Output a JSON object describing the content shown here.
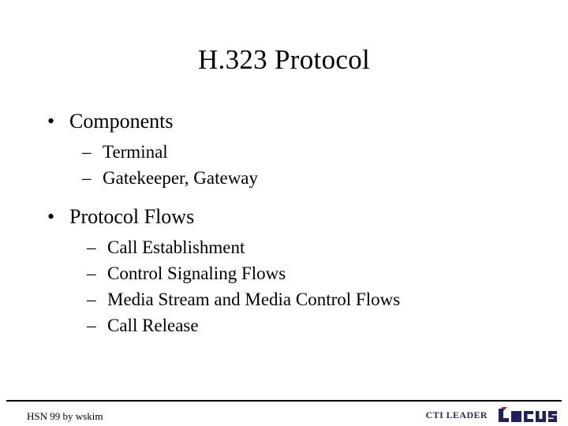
{
  "slide": {
    "title": "H.323 Protocol",
    "background_color": "#ffffff",
    "text_color": "#000000",
    "outline": [
      {
        "level": 1,
        "marker": "bullet-dot",
        "text": "Components",
        "children": [
          {
            "level": 2,
            "marker": "en-dash",
            "text": "Terminal"
          },
          {
            "level": 2,
            "marker": "en-dash",
            "text": "Gatekeeper, Gateway"
          }
        ]
      },
      {
        "level": 1,
        "marker": "bullet-dot",
        "text": "Protocol Flows",
        "children": [
          {
            "level": 2,
            "marker": "en-dash",
            "text": "Call Establishment"
          },
          {
            "level": 2,
            "marker": "en-dash",
            "text": "Control Signaling Flows"
          },
          {
            "level": 2,
            "marker": "en-dash",
            "text": "Media Stream and Media Control Flows"
          },
          {
            "level": 2,
            "marker": "en-dash",
            "text": "Call Release"
          }
        ]
      }
    ],
    "markers": {
      "bullet_dot": "•",
      "en_dash": "–"
    }
  },
  "footer": {
    "left_text": "HSN 99 by wskim",
    "tagline": "CTI LEADER",
    "tagline_color": "#2b2b55",
    "logo_text": "LOCUS",
    "logo_color": "#1f2160",
    "logo_accent_color": "#c02020",
    "rule_color": "#000000"
  }
}
